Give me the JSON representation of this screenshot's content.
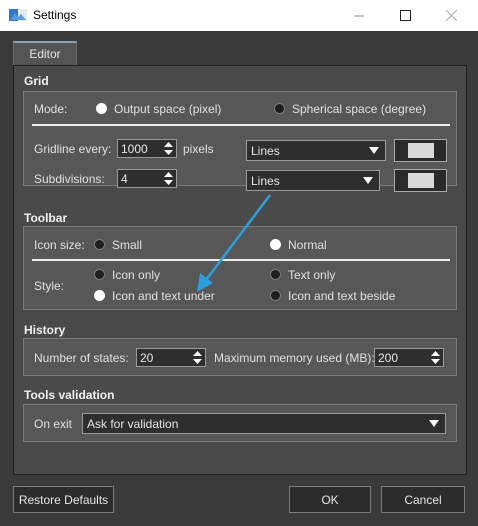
{
  "window": {
    "title": "Settings"
  },
  "tabs": [
    {
      "label": "Editor"
    }
  ],
  "grid": {
    "title": "Grid",
    "mode_label": "Mode:",
    "mode_options": [
      "Output space (pixel)",
      "Spherical space (degree)"
    ],
    "mode_selected": "Output space (pixel)",
    "gridline_label": "Gridline every:",
    "gridline_value": "1000",
    "gridline_unit": "pixels",
    "gridline_style": "Lines",
    "subdivisions_label": "Subdivisions:",
    "subdivisions_value": "4",
    "subdivisions_style": "Lines"
  },
  "toolbar": {
    "title": "Toolbar",
    "icon_size_label": "Icon size:",
    "icon_size_options": [
      "Small",
      "Normal"
    ],
    "icon_size_selected": "Normal",
    "style_label": "Style:",
    "style_options": [
      "Icon only",
      "Text only",
      "Icon and text under",
      "Icon and text beside"
    ],
    "style_selected": "Icon and text under"
  },
  "history": {
    "title": "History",
    "states_label": "Number of states:",
    "states_value": "20",
    "memory_label": "Maximum memory used (MB):",
    "memory_value": "200"
  },
  "tools_validation": {
    "title": "Tools validation",
    "on_exit_label": "On exit",
    "on_exit_value": "Ask for validation"
  },
  "buttons": {
    "restore": "Restore Defaults",
    "ok": "OK",
    "cancel": "Cancel"
  },
  "colors": {
    "dialog_bg": "#3a3a3a",
    "panel_bg": "#4a4a4a",
    "group_bg": "#575757",
    "arrow": "#29a0de"
  }
}
